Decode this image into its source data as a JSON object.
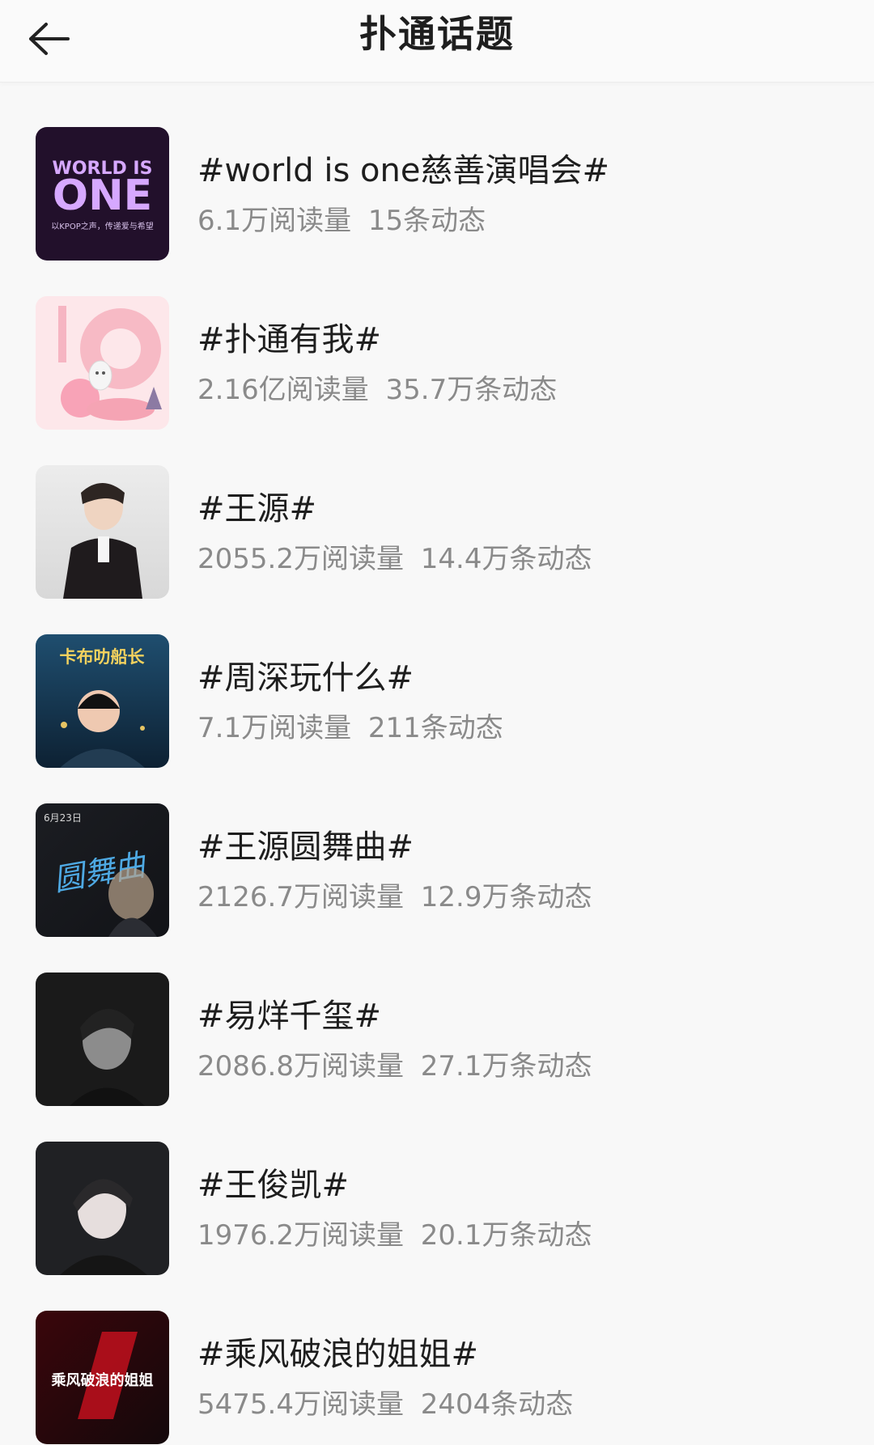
{
  "header": {
    "title": "扑通话题",
    "back_icon": "arrow-left-icon"
  },
  "topics": [
    {
      "title": "#world is one慈善演唱会#",
      "reads": "6.1万阅读量",
      "posts": "15条动态",
      "thumb_text": {
        "line1": "WORLD IS",
        "line2": "ONE",
        "line3": "以KPOP之声，传递爱与希望"
      }
    },
    {
      "title": "#扑通有我#",
      "reads": "2.16亿阅读量",
      "posts": "35.7万条动态"
    },
    {
      "title": "#王源#",
      "reads": "2055.2万阅读量",
      "posts": "14.4万条动态"
    },
    {
      "title": "#周深玩什么#",
      "reads": "7.1万阅读量",
      "posts": "211条动态",
      "thumb_text": {
        "line1": "卡布叻船长"
      }
    },
    {
      "title": "#王源圆舞曲#",
      "reads": "2126.7万阅读量",
      "posts": "12.9万条动态",
      "thumb_text": {
        "line1": "圆舞曲",
        "line2": "6月23日"
      }
    },
    {
      "title": "#易烊千玺#",
      "reads": "2086.8万阅读量",
      "posts": "27.1万条动态"
    },
    {
      "title": "#王俊凯#",
      "reads": "1976.2万阅读量",
      "posts": "20.1万条动态"
    },
    {
      "title": "#乘风破浪的姐姐#",
      "reads": "5475.4万阅读量",
      "posts": "2404条动态",
      "thumb_text": {
        "line1": "乘风破浪的姐姐"
      }
    }
  ]
}
